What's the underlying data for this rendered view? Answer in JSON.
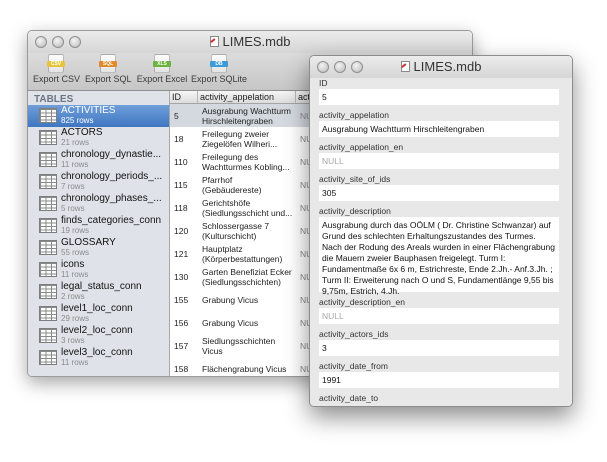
{
  "main_window": {
    "title": "LIMES.mdb",
    "toolbar": [
      {
        "label": "Export CSV",
        "badge": "CSV",
        "color": "#e6c53c",
        "icon": "csv-file-icon"
      },
      {
        "label": "Export SQL",
        "badge": "SQL",
        "color": "#e08a2c",
        "icon": "sql-file-icon"
      },
      {
        "label": "Export Excel",
        "badge": "XLS",
        "color": "#6db33f",
        "icon": "excel-file-icon"
      },
      {
        "label": "Export SQLite",
        "badge": "DB",
        "color": "#3c9bd6",
        "icon": "sqlite-file-icon"
      }
    ],
    "sidebar": {
      "header": "TABLES",
      "items": [
        {
          "name": "ACTIVITIES",
          "rows": "825 rows",
          "selected": true
        },
        {
          "name": "ACTORS",
          "rows": "21 rows"
        },
        {
          "name": "chronology_dynastie...",
          "rows": "11 rows"
        },
        {
          "name": "chronology_periods_...",
          "rows": "7 rows"
        },
        {
          "name": "chronology_phases_...",
          "rows": "5 rows"
        },
        {
          "name": "finds_categories_conn",
          "rows": "19 rows"
        },
        {
          "name": "GLOSSARY",
          "rows": "55 rows"
        },
        {
          "name": "icons",
          "rows": "11 rows"
        },
        {
          "name": "legal_status_conn",
          "rows": "2 rows"
        },
        {
          "name": "level1_loc_conn",
          "rows": "29 rows"
        },
        {
          "name": "level2_loc_conn",
          "rows": "3 rows"
        },
        {
          "name": "level3_loc_conn",
          "rows": "11 rows"
        }
      ]
    },
    "grid": {
      "columns": [
        "ID",
        "activity_appelation",
        "acti"
      ],
      "rows": [
        {
          "id": "5",
          "appelation": "Ausgrabung  Wachtturm Hirschleitengraben",
          "act": "NU",
          "selected": true
        },
        {
          "id": "18",
          "appelation": "Freilegung zweier Ziegelöfen Wilheri...",
          "act": "NU"
        },
        {
          "id": "110",
          "appelation": "Freilegung des Wachtturmes Kobling...",
          "act": "NU"
        },
        {
          "id": "115",
          "appelation": "Pfarrhof (Gebäudereste)",
          "act": "NU"
        },
        {
          "id": "118",
          "appelation": "Gerichtshöfe (Siedlungsschicht und...",
          "act": "NU"
        },
        {
          "id": "120",
          "appelation": "Schlossergasse 7 (Kulturschicht)",
          "act": "NU"
        },
        {
          "id": "121",
          "appelation": "Hauptplatz (Körperbestattungen)",
          "act": "NU"
        },
        {
          "id": "130",
          "appelation": "Garten Benefiziat Ecker (Siedlungsschichten)",
          "act": "NU"
        },
        {
          "id": "155",
          "appelation": "Grabung Vicus",
          "act": "NU"
        },
        {
          "id": "156",
          "appelation": "Grabung Vicus",
          "act": "NU"
        },
        {
          "id": "157",
          "appelation": "Siedlungsschichten Vicus",
          "act": "NU"
        },
        {
          "id": "158",
          "appelation": "Flächengrabung Vicus",
          "act": "NU"
        }
      ]
    }
  },
  "detail_window": {
    "title": "LIMES.mdb",
    "fields": [
      {
        "label": "ID",
        "value": "5"
      },
      {
        "label": "activity_appelation",
        "value": "Ausgrabung  Wachtturm Hirschleitengraben"
      },
      {
        "label": "activity_appelation_en",
        "value": "NULL",
        "null": true
      },
      {
        "label": "activity_site_of_ids",
        "value": "305"
      },
      {
        "label": "activity_description",
        "value": "Ausgrabung durch das OÖLM ( Dr. Christine Schwanzar) auf Grund des schlechten Erhaltungszustandes des Turmes. Nach der Rodung des Areals wurden in einer Flächengrabung die Mauern zweier Bauphasen freigelegt. Turm I: Fundamentmaße 6x 6 m, Estrichreste, Ende 2.Jh.- Anf.3.Jh. ; Turm II: Erweiterung nach O und S, Fundamentlänge 9,55 bis 9,75m, Estrich, 4.Jh."
      },
      {
        "label": "activity_description_en",
        "value": "NULL",
        "null": true
      },
      {
        "label": "activity_actors_ids",
        "value": "3"
      },
      {
        "label": "activity_date_from",
        "value": "1991"
      },
      {
        "label": "activity_date_to",
        "value": ""
      }
    ]
  }
}
